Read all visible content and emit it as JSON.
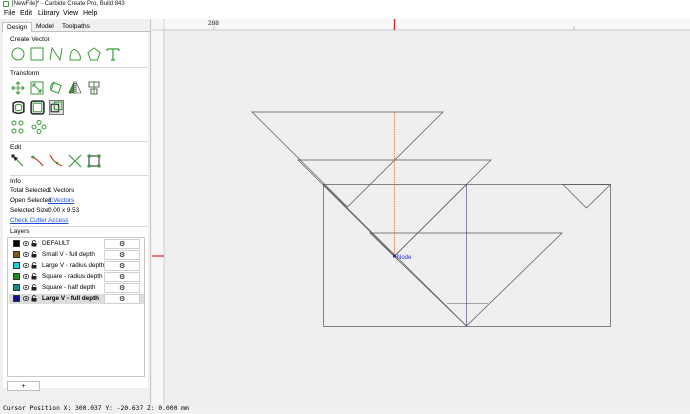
{
  "window": {
    "title": "[NewFile]* - Carbide Create Pro, Build 843"
  },
  "menu": [
    "File",
    "Edit",
    "Library",
    "View",
    "Help"
  ],
  "tabs": [
    "Design",
    "Model",
    "Toolpaths"
  ],
  "sections": {
    "create_vector": "Create Vector",
    "transform": "Transform",
    "edit": "Edit",
    "info": "Info",
    "layers": "Layers"
  },
  "info": {
    "total_selected_label": "Total Selected:",
    "total_selected_value": "1 Vectors",
    "open_selected_label": "Open Selected:",
    "open_selected_value": "1 Vectors",
    "selected_size_label": "Selected Size:",
    "selected_size_value": "0.00 x 9.53",
    "check_cutter_access": "Check Cutter Access"
  },
  "layers": [
    {
      "name": "DEFAULT",
      "color": "#000000",
      "selected": false
    },
    {
      "name": "Small V - full depth",
      "color": "#7a5a14",
      "selected": false
    },
    {
      "name": "Large V - radius depth",
      "color": "#18d0e0",
      "selected": false
    },
    {
      "name": "Square - radius depth",
      "color": "#1f8a1f",
      "selected": false
    },
    {
      "name": "Square - half depth",
      "color": "#148a8a",
      "selected": false
    },
    {
      "name": "Large V - full depth",
      "color": "#10108a",
      "selected": true
    }
  ],
  "gear_glyph": "⚙",
  "add_layer_label": "+",
  "ruler": {
    "label": "288"
  },
  "canvas": {
    "node_label": "Node"
  },
  "status": {
    "cursor": "Cursor Position X: 300.037 Y: -20.637 Z: 0.000 mm"
  },
  "colors": {
    "accent_green": "#3a9a3a",
    "marker_red": "#e02020",
    "selected_path": "#e07020",
    "node_blue": "#1a2ee0"
  }
}
